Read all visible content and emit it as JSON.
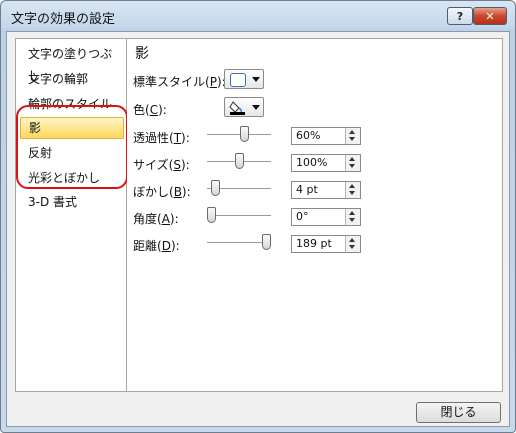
{
  "window": {
    "title": "文字の効果の設定"
  },
  "titlebar": {
    "help_label": "?",
    "close_label": "✕"
  },
  "nav": {
    "items": [
      {
        "label": "文字の塗りつぶし"
      },
      {
        "label": "文字の輪郭"
      },
      {
        "label": "輪郭のスタイル"
      },
      {
        "label": "影",
        "selected": true
      },
      {
        "label": "反射"
      },
      {
        "label": "光彩とぼかし"
      },
      {
        "label": "3-D 書式"
      }
    ]
  },
  "section": {
    "title": "影"
  },
  "controls": {
    "preset": {
      "label": "標準スタイル(",
      "key": "P",
      "end": "):"
    },
    "color": {
      "label": "色(",
      "key": "C",
      "end": "):",
      "swatch_color": "#000000"
    },
    "transparency": {
      "label": "透過性(",
      "key": "T",
      "end": "):",
      "value": "60%",
      "level": 0.6
    },
    "size": {
      "label": "サイズ(",
      "key": "S",
      "end": "):",
      "value": "100%",
      "level": 0.5
    },
    "blur": {
      "label": "ぼかし(",
      "key": "B",
      "end": "):",
      "value": "4 pt",
      "level": 0.07
    },
    "angle": {
      "label": "角度(",
      "key": "A",
      "end": "):",
      "value": "0°",
      "level": 0.0
    },
    "distance": {
      "label": "距離(",
      "key": "D",
      "end": "):",
      "value": "189 pt",
      "level": 1.0
    }
  },
  "footer": {
    "close_button": "閉じる"
  },
  "icons": {
    "fill_bucket": "paint-bucket-icon"
  }
}
